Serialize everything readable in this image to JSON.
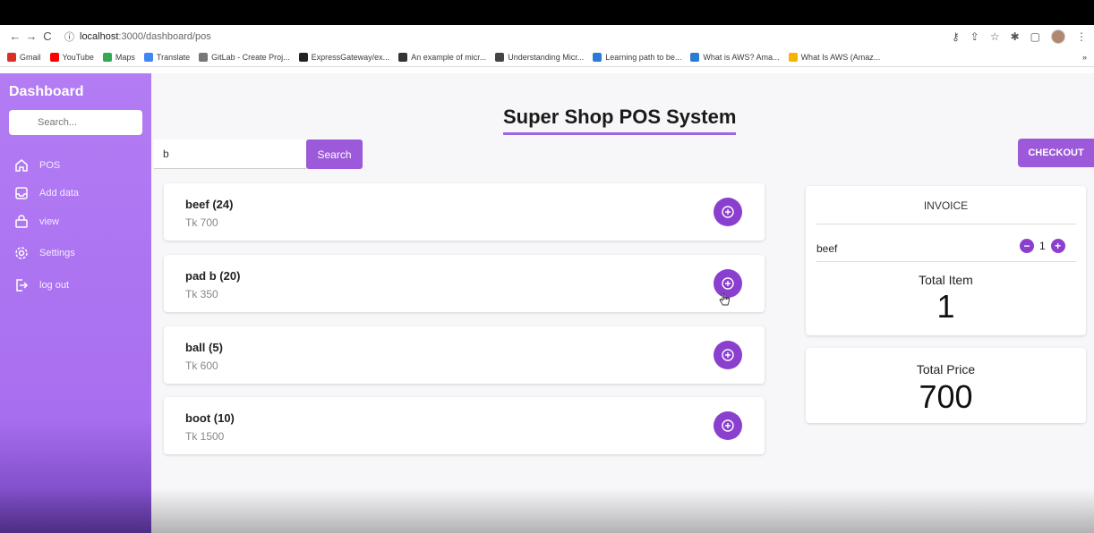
{
  "browser": {
    "url_host": "localhost",
    "url_path": ":3000/dashboard/pos",
    "bookmarks": [
      {
        "label": "Gmail",
        "color": "#d93025"
      },
      {
        "label": "YouTube",
        "color": "#ff0000"
      },
      {
        "label": "Maps",
        "color": "#34a853"
      },
      {
        "label": "Translate",
        "color": "#4285f4"
      },
      {
        "label": "GitLab - Create Proj...",
        "color": "#777777"
      },
      {
        "label": "ExpressGateway/ex...",
        "color": "#222222"
      },
      {
        "label": "An example of micr...",
        "color": "#333333"
      },
      {
        "label": "Understanding Micr...",
        "color": "#444444"
      },
      {
        "label": "Learning path to be...",
        "color": "#2b7bd6"
      },
      {
        "label": "What is AWS? Ama...",
        "color": "#2b7bd6"
      },
      {
        "label": "What Is AWS (Amaz...",
        "color": "#f4b400"
      }
    ],
    "more_bookmarks": "»"
  },
  "sidebar": {
    "title": "Dashboard",
    "search_placeholder": "Search...",
    "items": [
      {
        "label": "POS",
        "icon": "home-icon"
      },
      {
        "label": "Add data",
        "icon": "inbox-icon"
      },
      {
        "label": "view",
        "icon": "bag-icon"
      },
      {
        "label": "Settings",
        "icon": "gear-icon"
      },
      {
        "label": "log out",
        "icon": "logout-icon"
      }
    ]
  },
  "main": {
    "title": "Super Shop POS System",
    "search_value": "b",
    "search_button": "Search",
    "checkout_button": "CHECKOUT",
    "products": [
      {
        "name": "beef (24)",
        "price": "Tk 700"
      },
      {
        "name": "pad b (20)",
        "price": "Tk 350"
      },
      {
        "name": "ball (5)",
        "price": "Tk 600"
      },
      {
        "name": "boot (10)",
        "price": "Tk 1500"
      }
    ]
  },
  "invoice": {
    "title": "INVOICE",
    "items": [
      {
        "name": "beef",
        "qty": "1"
      }
    ],
    "total_item_label": "Total Item",
    "total_item_value": "1",
    "total_price_label": "Total Price",
    "total_price_value": "700"
  },
  "colors": {
    "accent": "#9c59d9",
    "sidebar": "#b37cf3",
    "add_button": "#8a3fcf"
  }
}
